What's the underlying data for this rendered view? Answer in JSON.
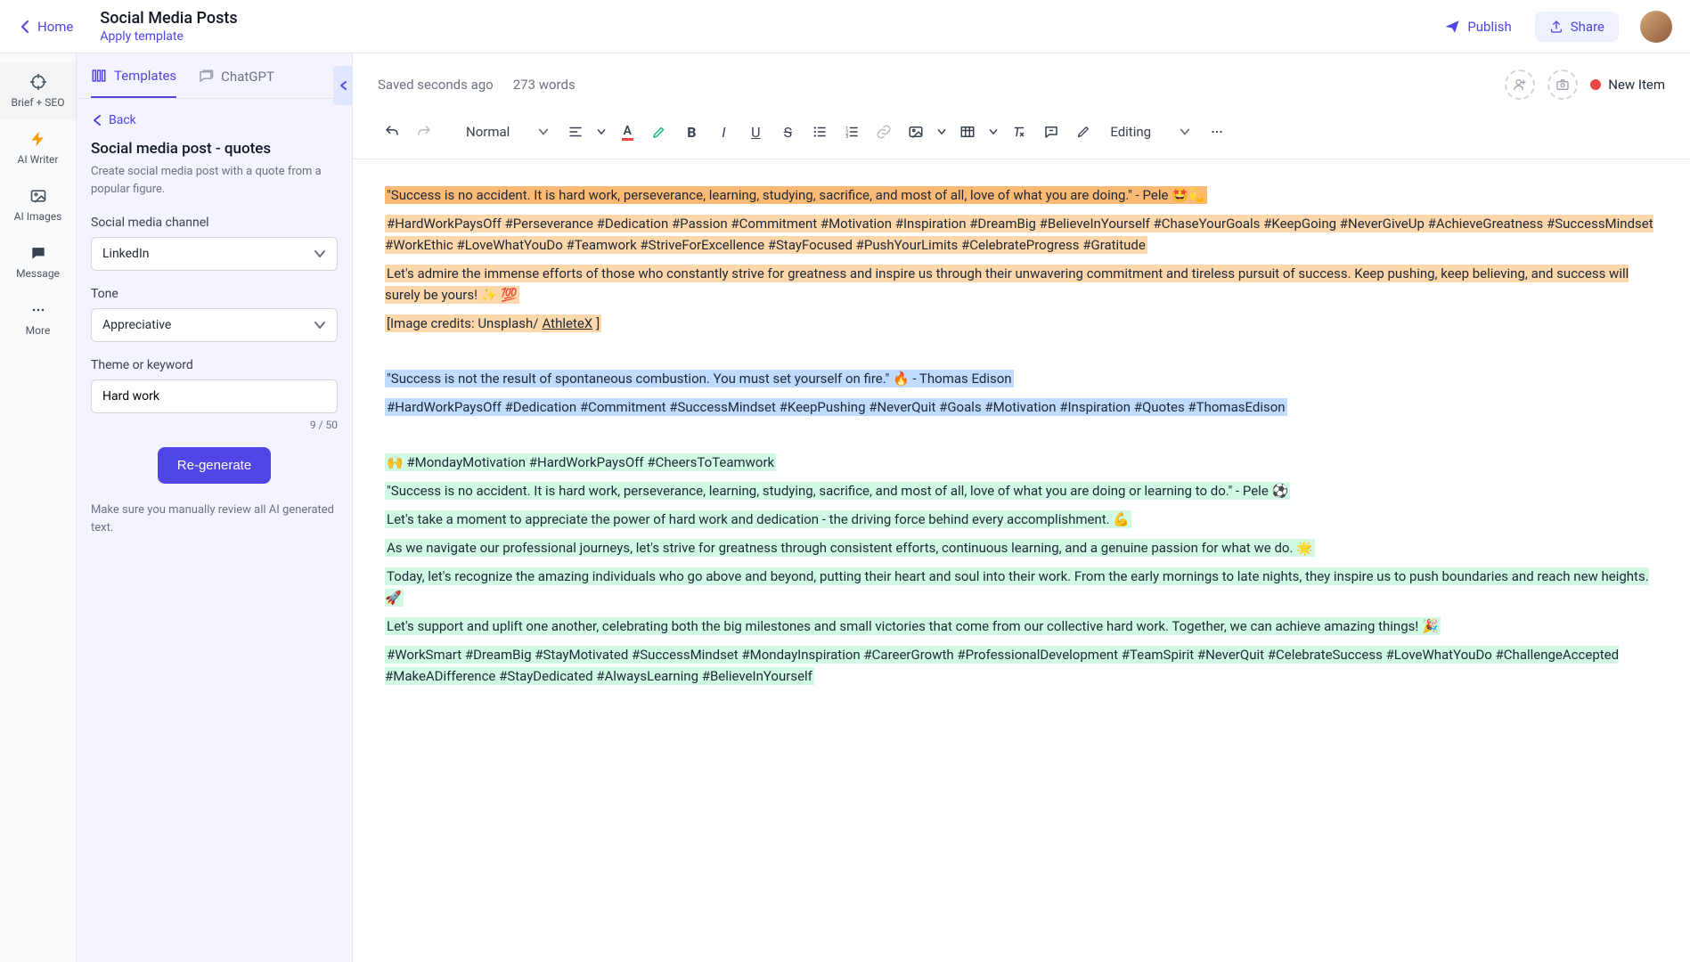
{
  "topbar": {
    "home_label": "Home",
    "page_title": "Social Media Posts",
    "apply_template": "Apply template",
    "publish_label": "Publish",
    "share_label": "Share"
  },
  "left_rail": {
    "brief_seo": "Brief + SEO",
    "ai_writer": "AI Writer",
    "ai_images": "AI Images",
    "message": "Message",
    "more": "More"
  },
  "panel": {
    "tab_templates": "Templates",
    "tab_chatgpt": "ChatGPT",
    "back_label": "Back",
    "heading": "Social media post - quotes",
    "description": "Create social media post with a quote from a popular figure.",
    "channel_label": "Social media channel",
    "channel_value": "LinkedIn",
    "tone_label": "Tone",
    "tone_value": "Appreciative",
    "theme_label": "Theme or keyword",
    "theme_value": "Hard work",
    "theme_count": "9 / 50",
    "regenerate_label": "Re-generate",
    "review_note": "Make sure you manually review all AI generated text."
  },
  "editor": {
    "saved_status": "Saved seconds ago",
    "word_count": "273 words",
    "new_item_label": "New Item",
    "style_normal": "Normal",
    "editing_label": "Editing"
  },
  "content": {
    "p1": "\"Success is no accident. It is hard work, perseverance, learning, studying, sacrifice, and most of all, love of what you are doing.\" - Pele 🤩💫",
    "p2": "#HardWorkPaysOff #Perseverance #Dedication #Passion #Commitment #Motivation #Inspiration #DreamBig #BelieveInYourself #ChaseYourGoals #KeepGoing #NeverGiveUp #AchieveGreatness #SuccessMindset #WorkEthic #LoveWhatYouDo #Teamwork #StriveForExcellence #StayFocused #PushYourLimits #CelebrateProgress #Gratitude",
    "p3": "Let's admire the immense efforts of those who constantly strive for greatness and inspire us through their unwavering commitment and tireless pursuit of success. Keep pushing, keep believing, and success will surely be yours! ✨ 💯",
    "p4a": "[Image credits: Unsplash/",
    "p4b": "AthleteX",
    "p4c": "]",
    "p5": "\"Success is not the result of spontaneous combustion. You must set yourself on fire.\" 🔥 - Thomas Edison",
    "p6": "#HardWorkPaysOff #Dedication #Commitment #SuccessMindset #KeepPushing #NeverQuit #Goals #Motivation #Inspiration #Quotes #ThomasEdison",
    "p7": "🙌 #MondayMotivation #HardWorkPaysOff #CheersToTeamwork",
    "p8": "\"Success is no accident. It is hard work, perseverance, learning, studying, sacrifice, and most of all, love of what you are doing or learning to do.\" - Pele ⚽",
    "p9": "Let's take a moment to appreciate the power of hard work and dedication - the driving force behind every accomplishment. 💪",
    "p10": "As we navigate our professional journeys, let's strive for greatness through consistent efforts, continuous learning, and a genuine passion for what we do. 🌟",
    "p11": "Today, let's recognize the amazing individuals who go above and beyond, putting their heart and soul into their work. From the early mornings to late nights, they inspire us to push boundaries and reach new heights. 🚀",
    "p12": "Let's support and uplift one another, celebrating both the big milestones and small victories that come from our collective hard work. Together, we can achieve amazing things! 🎉",
    "p13": "#WorkSmart #DreamBig #StayMotivated #SuccessMindset #MondayInspiration #CareerGrowth #ProfessionalDevelopment #TeamSpirit #NeverQuit #CelebrateSuccess #LoveWhatYouDo #ChallengeAccepted #MakeADifference #StayDedicated #AlwaysLearning #BelieveInYourself"
  }
}
